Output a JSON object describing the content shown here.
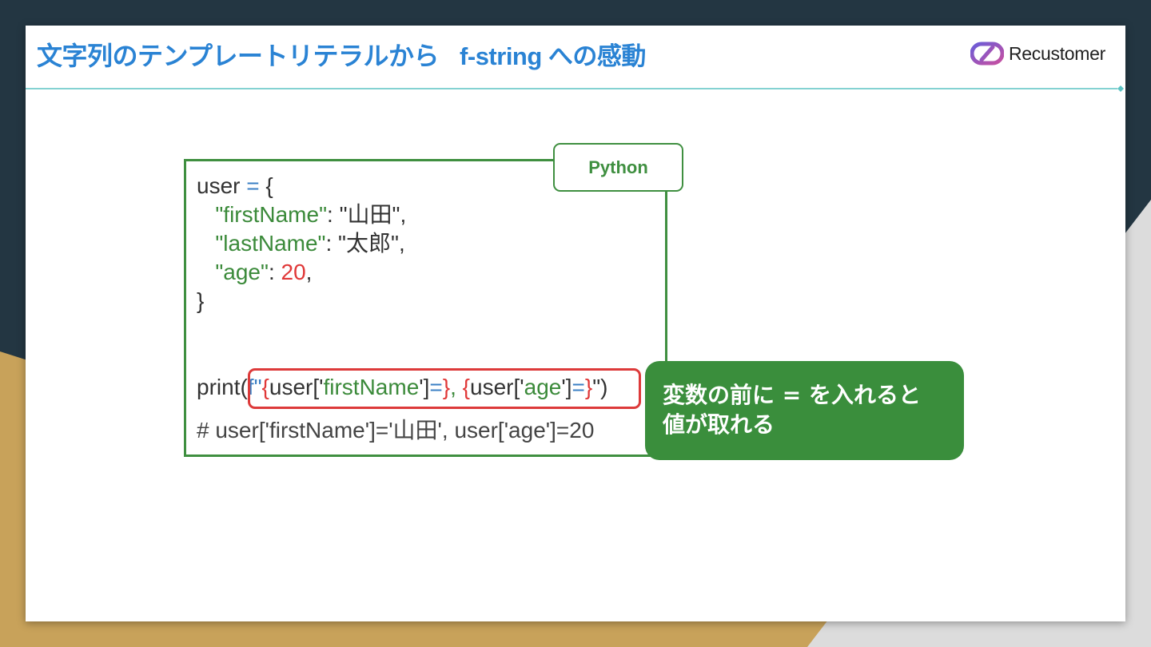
{
  "colors": {
    "background_dark": "#233642",
    "accent_gold": "#c8a25a",
    "title_blue": "#2a83d4",
    "divider_teal": "#5cc3c4",
    "code_green": "#3f8f40",
    "highlight_red": "#dd3a3a"
  },
  "header": {
    "title": "文字列のテンプレートリテラルから",
    "subtitle": "f-string への感動",
    "logo_text": "Recustomer",
    "logo_icon": "recustomer-logo-icon"
  },
  "code_panel": {
    "language": "Python",
    "lines": {
      "l1_var": "user",
      "l1_eq": "=",
      "l1_brace": "{",
      "l2_key": "\"firstName\"",
      "l2_sep": ": ",
      "l2_val": "\"山田\"",
      "l2_comma": ",",
      "l3_key": "\"lastName\"",
      "l3_sep": ": ",
      "l3_val": "\"太郎\"",
      "l3_comma": ",",
      "l4_key": "\"age\"",
      "l4_sep": ": ",
      "l4_val": "20",
      "l4_comma": ",",
      "l5_brace": "}",
      "print_fn": "print",
      "print_paren": "(",
      "print_f": "f\"",
      "print_ob1": "{",
      "print_user1": "user['",
      "print_key1": "firstName",
      "print_close1": "']",
      "print_eq1": "=",
      "print_cb1": "}",
      "print_mid": ", ",
      "print_ob2": "{",
      "print_user2": "user['",
      "print_key2": "age",
      "print_close2": "']",
      "print_eq2": "=",
      "print_cb2": "}",
      "print_end": "\")",
      "comment": "# user['firstName']='山田', user['age']=20"
    }
  },
  "callout": {
    "line1": "変数の前に = を入れると",
    "line2": "値が取れる"
  }
}
